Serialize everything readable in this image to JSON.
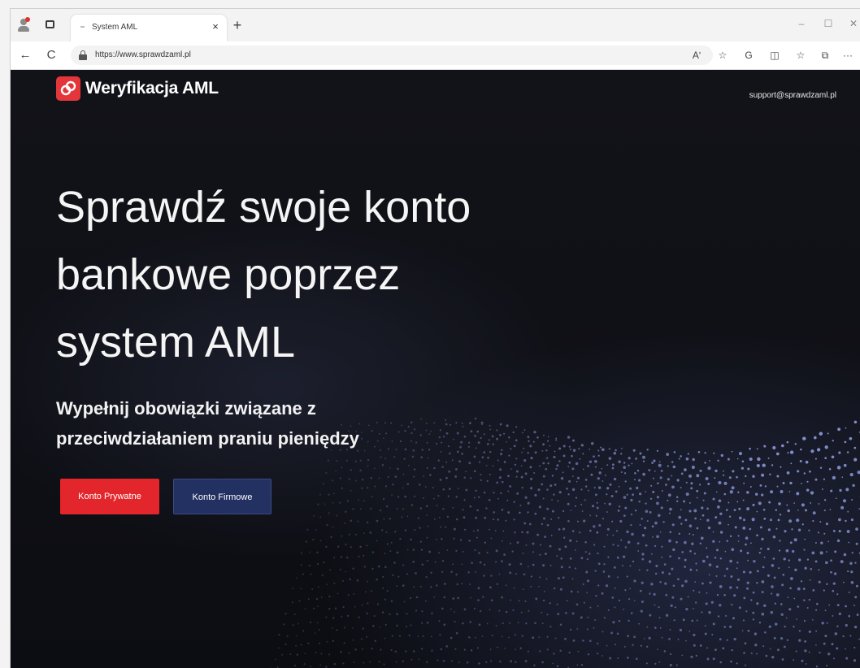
{
  "browser": {
    "tab_title": "System AML",
    "tab_close": "×",
    "new_tab": "+",
    "url": "https://www.sprawdzaml.pl",
    "window": {
      "minimize": "–",
      "maximize": "☐",
      "close": "✕"
    },
    "nav": {
      "back": "←",
      "reload": "C"
    },
    "toolbar_icons": {
      "read_aloud": "Aʹ",
      "favorite": "☆",
      "refresh_alt": "G",
      "split": "◫",
      "collections": "☆",
      "copilot": "⧉",
      "more": "···"
    }
  },
  "site": {
    "logo_text": "Weryfikacja AML",
    "support_email": "support@sprawdzaml.pl",
    "hero_title_lines": [
      "Sprawdź swoje konto",
      "bankowe poprzez",
      "system AML"
    ],
    "hero_subtitle_lines": [
      "Wypełnij obowiązki związane z",
      "przeciwdziałaniem praniu pieniędzy"
    ],
    "buttons": {
      "private": "Konto Prywatne",
      "business": "Konto Firmowe"
    }
  },
  "colors": {
    "accent_red": "#e3262b",
    "button_navy": "#233062",
    "page_bg": "#121319"
  }
}
